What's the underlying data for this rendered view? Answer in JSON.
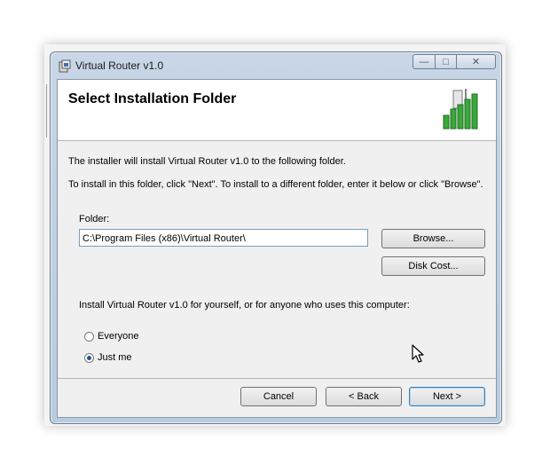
{
  "window": {
    "title": "Virtual Router v1.0",
    "controls": {
      "minimize": "—",
      "maximize": "□",
      "close": "✕"
    }
  },
  "header": {
    "title": "Select Installation Folder"
  },
  "body": {
    "line1": "The installer will install Virtual Router v1.0 to the following folder.",
    "line2": "To install in this folder, click \"Next\". To install to a different folder, enter it below or click \"Browse\".",
    "folder_label": "Folder:",
    "folder_value": "C:\\Program Files (x86)\\Virtual Router\\",
    "browse_label": "Browse...",
    "disk_cost_label": "Disk Cost...",
    "install_for_text": "Install Virtual Router v1.0 for yourself, or for anyone who uses this computer:",
    "radios": [
      {
        "label": "Everyone",
        "checked": false
      },
      {
        "label": "Just me",
        "checked": true
      }
    ]
  },
  "footer": {
    "cancel_label": "Cancel",
    "back_label": "< Back",
    "next_label": "Next >"
  },
  "icons": {
    "app": "installer-icon",
    "logo": "signal-bars-logo",
    "cursor": "mouse-pointer"
  }
}
